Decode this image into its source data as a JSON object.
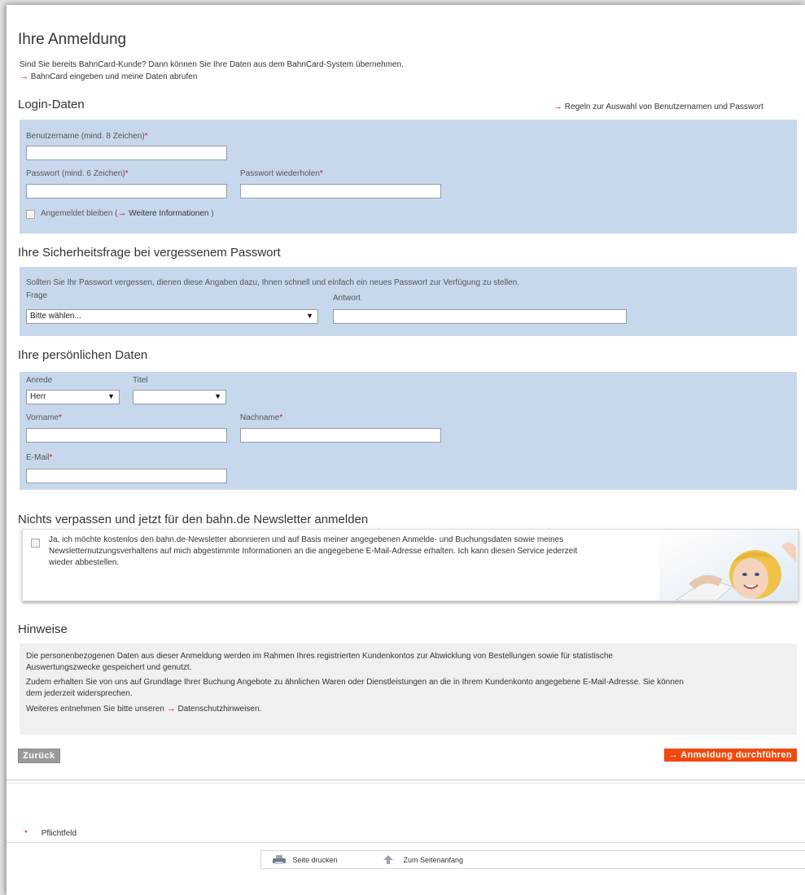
{
  "header": {
    "title": "Ihre Anmeldung",
    "intro": "Sind Sie bereits BahnCard-Kunde? Dann können Sie Ihre Daten aus dem BahnCard-System übernehmen.",
    "bahncard_link": "BahnCard eingeben und meine Daten abrufen"
  },
  "login": {
    "heading": "Login-Daten",
    "rules_link": "Regeln zur Auswahl von Benutzernamen und Passwort",
    "username_label": "Benutzername (mind. 8 Zeichen)",
    "password_label": "Passwort (mind. 6 Zeichen)",
    "password_repeat_label": "Passwort wiederholen",
    "stay_logged_in": "Angemeldet bleiben (",
    "more_info_link": "Weitere Informationen",
    "close_paren": ")"
  },
  "security": {
    "heading": "Ihre Sicherheitsfrage bei vergessenem Passwort",
    "description": "Sollten Sie Ihr Passwort vergessen, dienen diese Angaben dazu, Ihnen schnell und einfach ein neues Passwort zur Verfügung zu stellen.",
    "question_label": "Frage",
    "question_value": "Bitte wählen...",
    "answer_label": "Antwort"
  },
  "personal": {
    "heading": "Ihre persönlichen Daten",
    "salutation_label": "Anrede",
    "salutation_value": "Herr",
    "title_label": "Titel",
    "title_value": "",
    "firstname_label": "Vorname",
    "lastname_label": "Nachname",
    "email_label": "E-Mail"
  },
  "newsletter": {
    "heading": "Nichts verpassen und jetzt für den bahn.de Newsletter anmelden",
    "text_line1": "Ja, ich möchte kostenlos den bahn.de-Newsletter abonnieren und auf Basis meiner angegebenen Anmelde- und Buchungsdaten sowie meines",
    "text_line2": "Newsletternutzungsverhaltens auf mich abgestimmte Informationen an die angegebene E-Mail-Adresse erhalten. Ich kann diesen Service jederzeit",
    "text_line3": "wieder abbestellen."
  },
  "notes": {
    "heading": "Hinweise",
    "p1_line1": "Die personenbezogenen Daten aus dieser Anmeldung werden im Rahmen Ihres registrierten Kundenkontos zur Abwicklung von Bestellungen sowie für statistische",
    "p1_line2": "Auswertungszwecke gespeichert und genutzt.",
    "p2_line1": "Zudem erhalten Sie von uns auf Grundlage Ihrer Buchung Angebote zu ähnlichen Waren oder Dienstleistungen an die in Ihrem Kundenkonto angegebene E-Mail-Adresse. Sie können",
    "p2_line2": "dem jederzeit widersprechen.",
    "p3_prefix": "Weiteres entnehmen Sie bitte unseren",
    "privacy_link": "Datenschutzhinweisen."
  },
  "actions": {
    "back": "Zurück",
    "submit": "Anmeldung durchführen"
  },
  "footer": {
    "required_star": "*",
    "required_label": "Pflichtfeld",
    "print": "Seite drucken",
    "top": "Zum Seitenanfang"
  },
  "colors": {
    "accent": "#ec0016",
    "panel_blue": "#c8d8ec",
    "submit_orange": "#f04a0f",
    "panel_gray": "#f0f0f0"
  }
}
